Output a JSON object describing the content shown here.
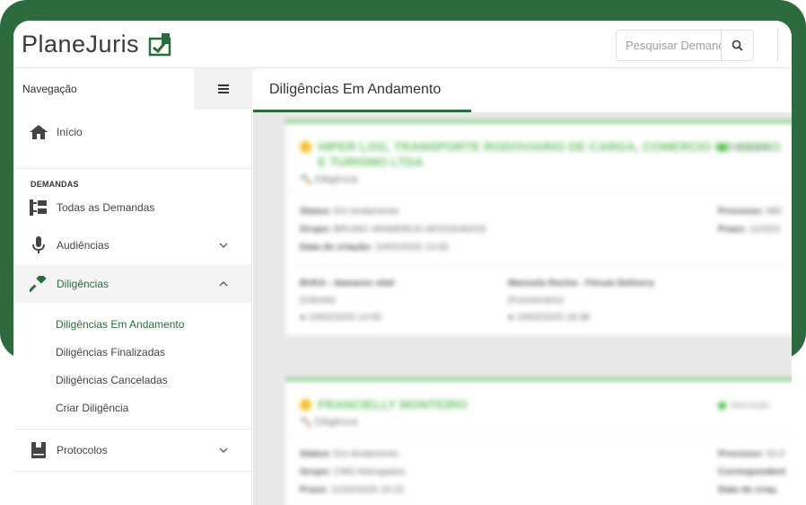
{
  "header": {
    "logo_text": "PlaneJuris",
    "search_placeholder": "Pesquisar Demandas"
  },
  "sidebar": {
    "title": "Navegação",
    "items": [
      {
        "label": "Início",
        "icon": "home-icon"
      },
      {
        "section": "DEMANDAS"
      },
      {
        "label": "Todas as Demandas",
        "icon": "folder-tree-icon"
      },
      {
        "label": "Audiências",
        "icon": "microphone-icon"
      },
      {
        "label": "Diligências",
        "icon": "gavel-icon"
      },
      {
        "label": "Protocolos",
        "icon": "book-icon"
      }
    ],
    "subitems": [
      "Diligências Em Andamento",
      "Diligências Finalizadas",
      "Diligências Canceladas",
      "Criar Diligência"
    ]
  },
  "main": {
    "page_title": "Diligências Em Andamento",
    "cards": [
      {
        "title": "HIPER LOG, TRANSPORTE RODOVIARIO DE CARGA, COMERCIO DE GESSO E TURISMO LTDA",
        "type": "Diligência",
        "marker": "Marcação",
        "status_label": "Status:",
        "status": "Em Andamento",
        "group_label": "Grupo:",
        "group": "BRUNO VANDERLEI ADVOGADOS",
        "date_label": "Data de criação:",
        "date": "10/02/2025 14:55",
        "process_label": "Processo:",
        "process": "080",
        "deadline_label": "Prazo:",
        "deadline": "11/02/2",
        "person1_name": "BVAA - damares vital",
        "person1_role": "(Cliente)",
        "person1_date": "10/02/2025 14:55",
        "person2_name": "Manoela Rocha - Fórum Delivery",
        "person2_role": "(Funcionário)",
        "person2_date": "10/02/2025 18:38"
      },
      {
        "title": "FRANCIELLY MONTEIRO",
        "type": "Diligência",
        "marker": "Marcação",
        "status_label": "Status:",
        "status": "Em Andamento",
        "group_label": "Grupo:",
        "group": "CMO Advogados",
        "date_label": "Prazo:",
        "date": "11/02/2025 15:15",
        "process_label": "Processo:",
        "process": "52.0",
        "deadline_label": "Correspondent",
        "deadline": "",
        "extra_label": "Data de criaç",
        "extra": ""
      }
    ]
  },
  "colors": {
    "brand_green": "#2d6a3e",
    "card_accent": "#6cc36a",
    "status_dot": "#48c246",
    "warning_dot": "#f7c12a"
  }
}
